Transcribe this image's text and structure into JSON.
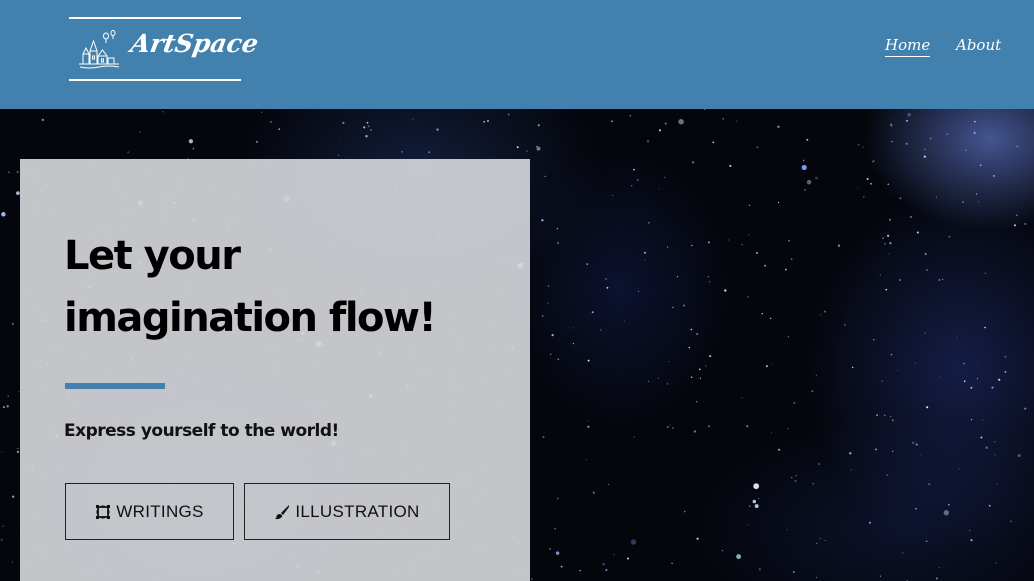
{
  "header": {
    "brand": "ArtSpace",
    "logo_icon": "castle-balloons-icon",
    "nav": [
      {
        "label": "Home",
        "active": true
      },
      {
        "label": "About",
        "active": false
      }
    ],
    "background_color": "#4281ad"
  },
  "hero": {
    "headline_line1": "Let your",
    "headline_line2": "imagination flow!",
    "subtitle": "Express yourself to the world!",
    "accent_color": "#4281ad",
    "buttons": [
      {
        "label": "WRITINGS",
        "icon": "frame-icon"
      },
      {
        "label": "ILLUSTRATION",
        "icon": "brush-icon"
      }
    ]
  }
}
